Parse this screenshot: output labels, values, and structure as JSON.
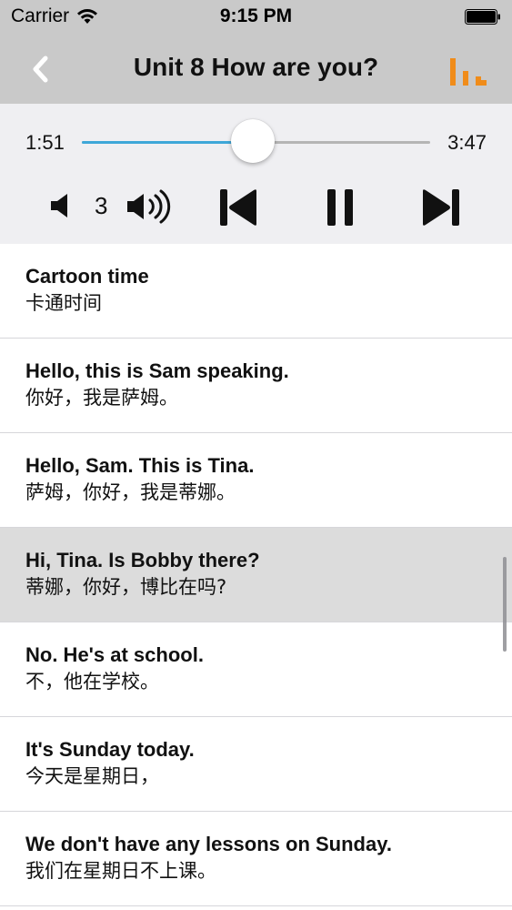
{
  "status_bar": {
    "carrier": "Carrier",
    "time": "9:15 PM"
  },
  "nav": {
    "title": "Unit 8 How are you?",
    "accent_color": "#f08c1a"
  },
  "player": {
    "elapsed": "1:51",
    "total": "3:47",
    "progress": 0.49,
    "volume": "3",
    "progress_color": "#3ea7d8"
  },
  "lyrics": [
    {
      "en": "Cartoon time",
      "zh": "卡通时间"
    },
    {
      "en": "Hello, this is Sam speaking.",
      "zh": "你好，我是萨姆。"
    },
    {
      "en": "Hello, Sam. This is Tina.",
      "zh": "萨姆，你好，我是蒂娜。"
    },
    {
      "en": "Hi, Tina. Is Bobby there?",
      "zh": "蒂娜，你好，博比在吗?"
    },
    {
      "en": "No. He's at school.",
      "zh": "不，他在学校。"
    },
    {
      "en": "It's Sunday today.",
      "zh": "今天是星期日，"
    },
    {
      "en": "We don't have any lessons on Sunday.",
      "zh": "我们在星期日不上课。"
    }
  ],
  "active_lyric": 3
}
